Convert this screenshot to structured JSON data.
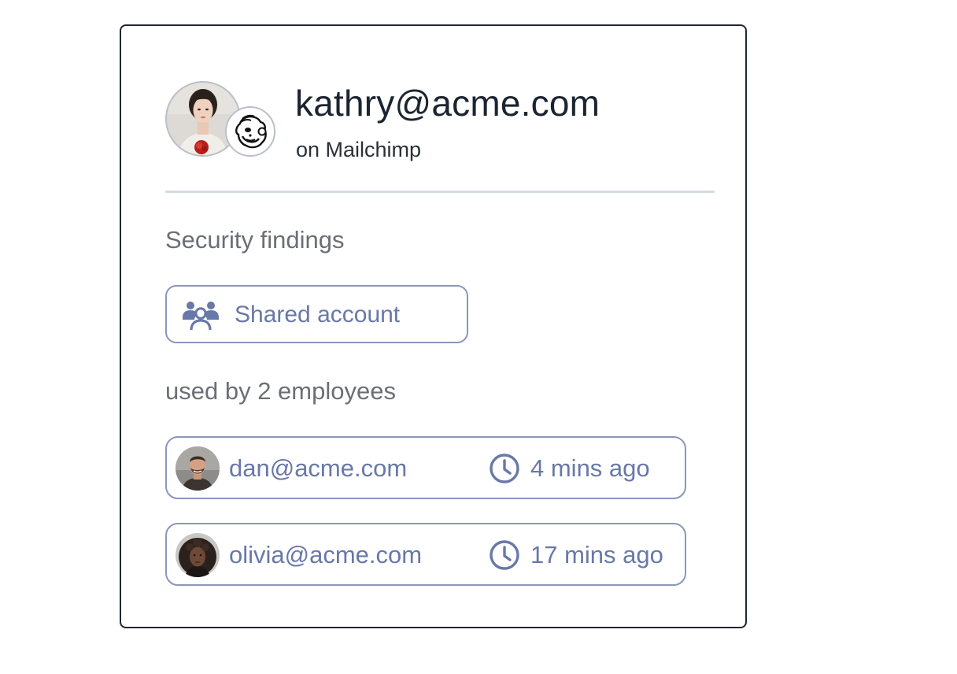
{
  "account": {
    "email": "kathry@acme.com",
    "app": "on Mailchimp"
  },
  "icons": {
    "avatar": "user-avatar",
    "app_badge": "mailchimp-logo-icon",
    "finding": "users-group-icon",
    "time": "clock-icon"
  },
  "colors": {
    "accent": "#6878a8",
    "chip_border": "#8a97b9",
    "title_text": "#1b2430",
    "section_text": "#6b6f75",
    "divider": "#d3dbe5",
    "card_border": "#1f2733"
  },
  "findings": {
    "title": "Security findings",
    "items": [
      {
        "label": "Shared account"
      }
    ]
  },
  "employees": {
    "title": "used by 2 employees",
    "items": [
      {
        "email": "dan@acme.com",
        "time": "4 mins ago"
      },
      {
        "email": "olivia@acme.com",
        "time": "17 mins ago"
      }
    ]
  }
}
